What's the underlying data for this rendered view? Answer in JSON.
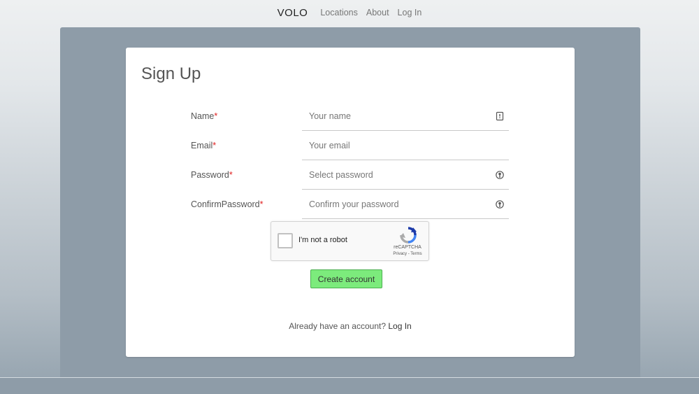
{
  "nav": {
    "brand": "VOLO",
    "links": [
      "Locations",
      "About",
      "Log In"
    ]
  },
  "form": {
    "title": "Sign Up",
    "fields": [
      {
        "label": "Name",
        "required_mark": "*",
        "placeholder": "Your name",
        "icon": "contact-card-icon"
      },
      {
        "label": "Email",
        "required_mark": "*",
        "placeholder": "Your email",
        "icon": ""
      },
      {
        "label": "Password",
        "required_mark": "*",
        "placeholder": "Select password",
        "icon": "password-key-icon"
      },
      {
        "label": "ConfirmPassword",
        "required_mark": "*",
        "placeholder": "Confirm your password",
        "icon": "password-key-icon"
      }
    ],
    "captcha": {
      "label": "I'm not a robot",
      "brand": "reCAPTCHA",
      "links": "Privacy - Terms"
    },
    "submit_label": "Create account",
    "login_prompt": "Already have an account?",
    "login_link": "Log In"
  },
  "colors": {
    "panel": "#8e9ca8",
    "submit_bg": "#7ceb7c",
    "required": "#e02020"
  }
}
